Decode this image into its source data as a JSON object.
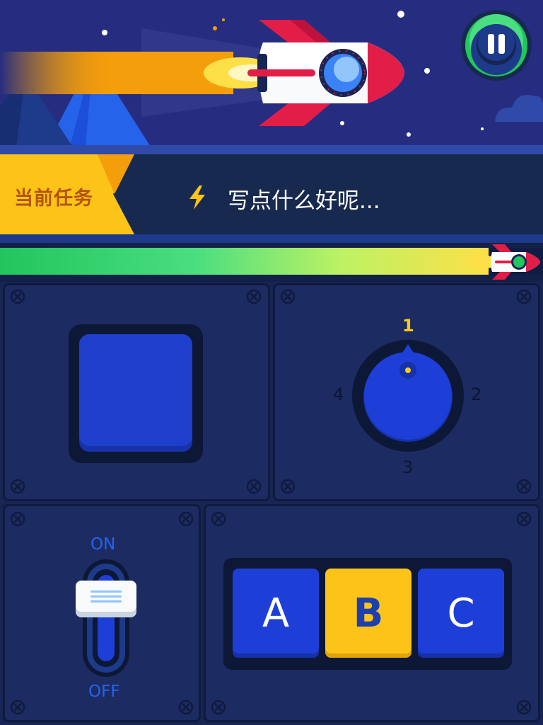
{
  "task": {
    "label": "当前任务",
    "text": "写点什么好呢..."
  },
  "progress": {
    "fraction": 0.9
  },
  "dial": {
    "selected": "1",
    "labels": [
      "1",
      "2",
      "3",
      "4"
    ]
  },
  "switch": {
    "on_label": "ON",
    "off_label": "OFF",
    "state": "on"
  },
  "keys": {
    "a": "A",
    "b": "B",
    "c": "C",
    "selected": "B"
  },
  "colors": {
    "accent_yellow": "#fcc419",
    "button_blue": "#1d3fd8",
    "panel": "#1d2b63",
    "progress_green": "#22c55e",
    "rocket_red": "#e11d48"
  },
  "icons": {
    "pause": "pause-icon",
    "bolt": "lightning-icon",
    "rocket": "rocket-icon",
    "screw": "screw-icon"
  }
}
